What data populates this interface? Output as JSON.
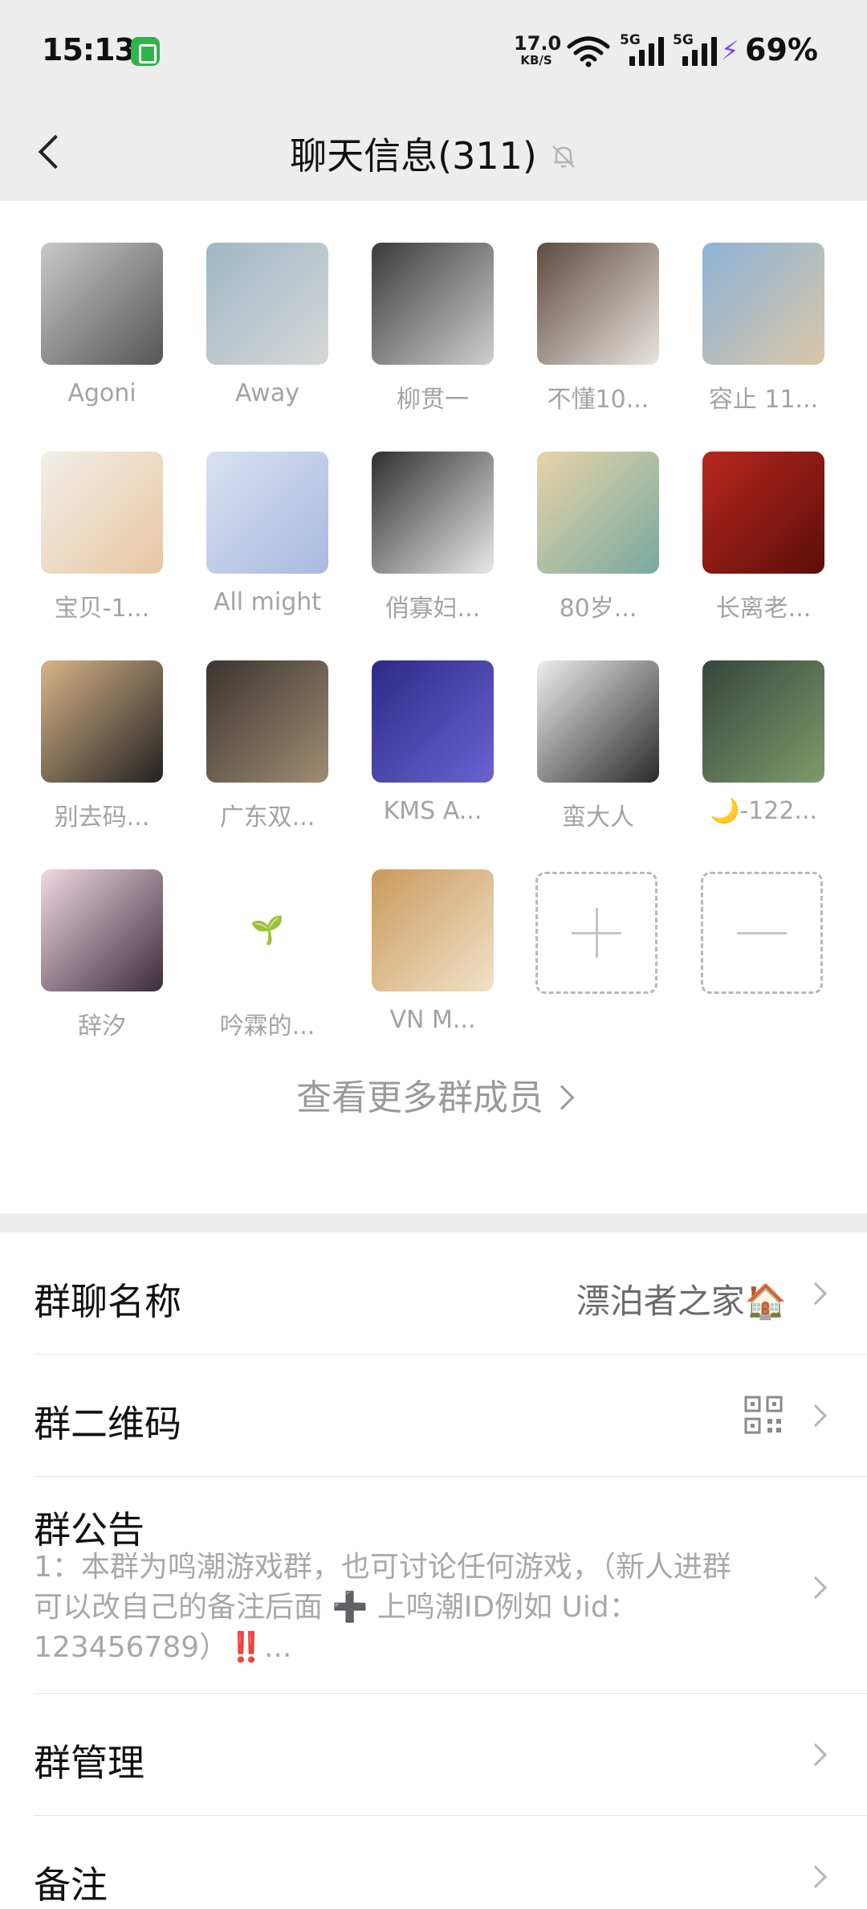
{
  "status_bar": {
    "time": "15:13",
    "net_speed_value": "17.0",
    "net_speed_unit": "KB/S",
    "signal1_label": "5G",
    "signal2_label": "5G",
    "battery": "69%"
  },
  "nav": {
    "title": "聊天信息(311)"
  },
  "members": [
    {
      "name": "Agoni",
      "colors": [
        "#c9c9c9",
        "#555555"
      ]
    },
    {
      "name": "Away",
      "colors": [
        "#9fb7c4",
        "#d7d7d7"
      ]
    },
    {
      "name": "柳贯一",
      "colors": [
        "#3a3a3a",
        "#cfcfcf"
      ]
    },
    {
      "name": "不懂10...",
      "colors": [
        "#5c4b40",
        "#e9e4df"
      ]
    },
    {
      "name": "容止 11...",
      "colors": [
        "#8db3d8",
        "#d9c6a6"
      ]
    },
    {
      "name": "宝贝-1...",
      "colors": [
        "#f2efe9",
        "#e7c6a2"
      ]
    },
    {
      "name": "All might",
      "colors": [
        "#d9e2f1",
        "#a8b9de"
      ]
    },
    {
      "name": "俏寡妇...",
      "colors": [
        "#2f2f2f",
        "#e9e9e9"
      ]
    },
    {
      "name": "80岁...",
      "colors": [
        "#e7d4a8",
        "#79a9a0"
      ]
    },
    {
      "name": "长离老...",
      "colors": [
        "#b8271d",
        "#5b0e0a"
      ]
    },
    {
      "name": "别去码...",
      "colors": [
        "#d9b588",
        "#222222"
      ]
    },
    {
      "name": "广东双...",
      "colors": [
        "#3a3530",
        "#a08c72"
      ]
    },
    {
      "name": "KMS A...",
      "colors": [
        "#2d2a86",
        "#6b63d1"
      ]
    },
    {
      "name": "蛮大人",
      "colors": [
        "#eeeeee",
        "#2a2a2a"
      ]
    },
    {
      "name": "🌙-122...",
      "colors": [
        "#35463c",
        "#7e9b6b"
      ]
    },
    {
      "name": "辞汐",
      "colors": [
        "#f1d8e2",
        "#3b2c3a"
      ]
    },
    {
      "name": "吟霖的...",
      "colors": [
        "#ffffff",
        "#ffffff"
      ]
    },
    {
      "name": "VN   M...",
      "colors": [
        "#c99a5c",
        "#f1e2c9"
      ]
    }
  ],
  "see_more": "查看更多群成员",
  "settings": {
    "group_name_label": "群聊名称",
    "group_name_value": "漂泊者之家🏠",
    "qr_label": "群二维码",
    "notice_label": "群公告",
    "notice_text": "1：本群为鸣潮游戏群，也可讨论任何游戏，（新人进群可以改自己的备注后面 ➕ 上鸣潮ID例如 Uid：123456789）‼️...",
    "manage_label": "群管理",
    "remark_label": "备注"
  }
}
